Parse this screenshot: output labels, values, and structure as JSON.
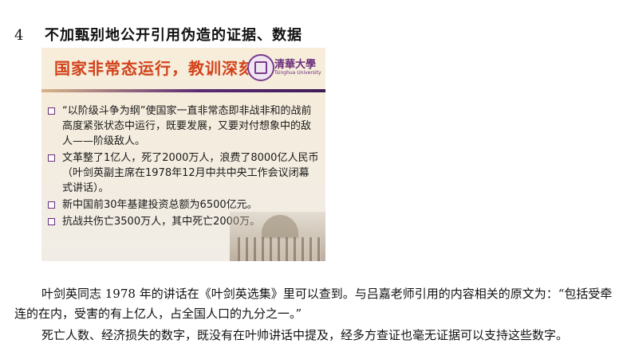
{
  "heading": {
    "number": "4",
    "text": "不加甄别地公开引用伪造的证据、数据"
  },
  "slide": {
    "title": "国家非常态运行，教训深刻",
    "logo_text": "清華大學",
    "logo_subtext": "Tsinghua University",
    "bullets": [
      "“以阶级斗争为纲”使国家一直非常态即非战非和的战前高度紧张状态中运行，既要发展，又要对付想象中的敌人——阶级敌人。",
      "文革整了1亿人，死了2000万人，浪费了8000亿人民币（叶剑英副主席在1978年12月中共中央工作会议闭幕式讲话）。",
      "新中国前30年基建投资总额为6500亿元。",
      "抗战共伤亡3500万人，其中死亡2000万。"
    ]
  },
  "body": {
    "paragraph_1": "叶剑英同志 1978 年的讲话在《叶剑英选集》里可以查到。与吕嘉老师引用的内容相关的原文为：“包括受牵连的在内，受害的有上亿人，占全国人口的九分之一。”",
    "paragraph_2": "死亡人数、经济损失的数字，既没有在叶帅讲话中提及，经多方查证也毫无证据可以支持这些数字。"
  }
}
